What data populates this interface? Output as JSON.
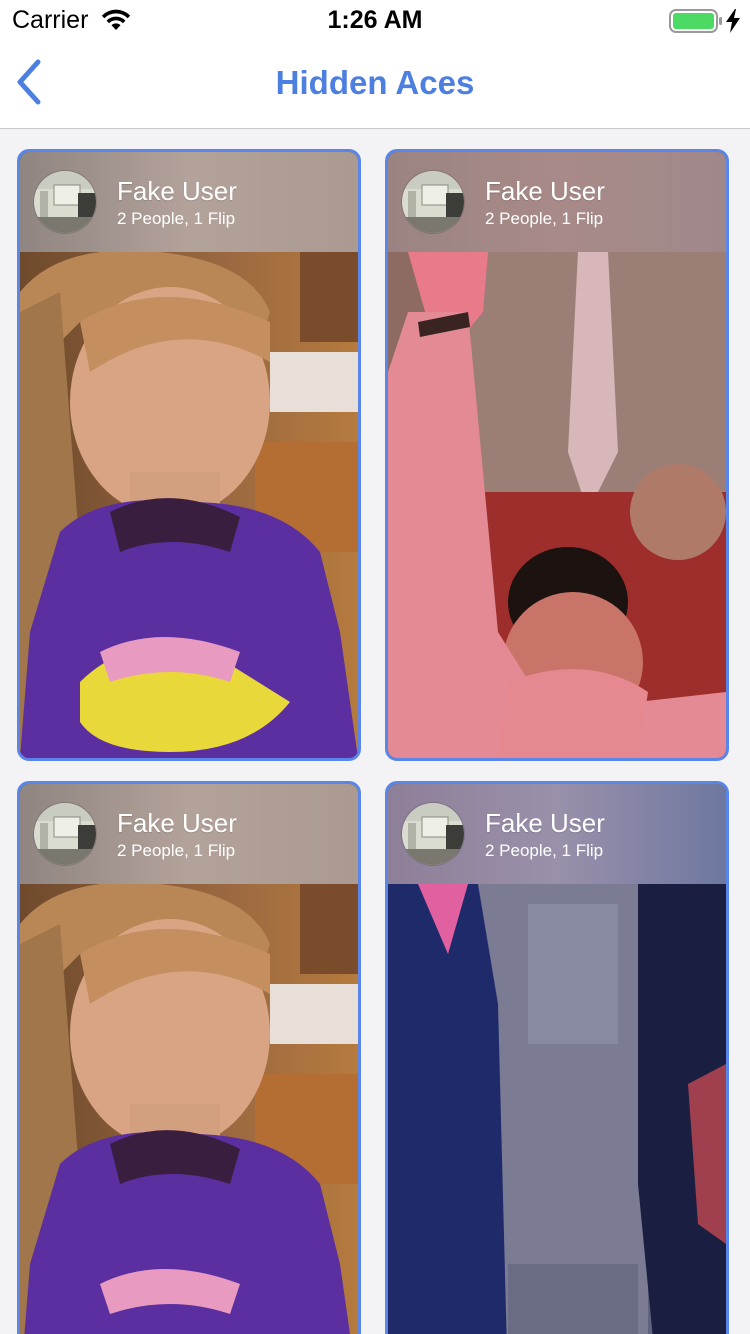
{
  "status_bar": {
    "carrier": "Carrier",
    "time": "1:26 AM",
    "icons": [
      "wifi-icon",
      "battery-icon",
      "charging-bolt-icon"
    ]
  },
  "nav": {
    "title": "Hidden Aces",
    "back_icon": "chevron-left-icon"
  },
  "colors": {
    "accent": "#4d7fe0",
    "card_border": "#5a86ea",
    "battery_fill": "#4cd964"
  },
  "cards": [
    {
      "user": "Fake User",
      "meta": "2 People, 1 Flip",
      "media": "girl-purple-sweater-gif"
    },
    {
      "user": "Fake User",
      "meta": "2 People, 1 Flip",
      "media": "audience-raised-hand-gif"
    },
    {
      "user": "Fake User",
      "meta": "2 People, 1 Flip",
      "media": "girl-purple-sweater-gif"
    },
    {
      "user": "Fake User",
      "meta": "2 People, 1 Flip",
      "media": "blue-figures-gif"
    }
  ]
}
